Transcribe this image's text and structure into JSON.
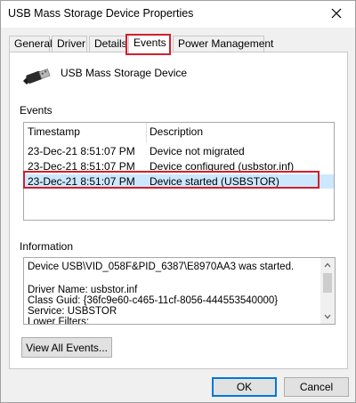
{
  "window": {
    "title": "USB Mass Storage Device Properties"
  },
  "tabs": [
    {
      "label": "General",
      "active": false
    },
    {
      "label": "Driver",
      "active": false
    },
    {
      "label": "Details",
      "active": false
    },
    {
      "label": "Events",
      "active": true
    },
    {
      "label": "Power Management",
      "active": false
    }
  ],
  "device": {
    "name": "USB Mass Storage Device",
    "icon": "usb-plug-icon"
  },
  "events": {
    "label": "Events",
    "columns": [
      "Timestamp",
      "Description"
    ],
    "rows": [
      {
        "timestamp": "23-Dec-21 8:51:07 PM",
        "description": "Device not migrated",
        "selected": false
      },
      {
        "timestamp": "23-Dec-21 8:51:07 PM",
        "description": "Device configured (usbstor.inf)",
        "selected": false
      },
      {
        "timestamp": "23-Dec-21 8:51:07 PM",
        "description": "Device started (USBSTOR)",
        "selected": true
      }
    ]
  },
  "information": {
    "label": "Information",
    "lines": [
      "Device USB\\VID_058F&PID_6387\\E8970AA3 was started.",
      "",
      "Driver Name: usbstor.inf",
      "Class Guid: {36fc9e60-c465-11cf-8056-444553540000}",
      "Service: USBSTOR",
      "Lower Filters:"
    ]
  },
  "buttons": {
    "view_all_events": "View All Events...",
    "ok": "OK",
    "cancel": "Cancel"
  },
  "colors": {
    "highlight_red": "#d0202c",
    "selection": "#cce8ff",
    "default_button_border": "#0078d7"
  }
}
